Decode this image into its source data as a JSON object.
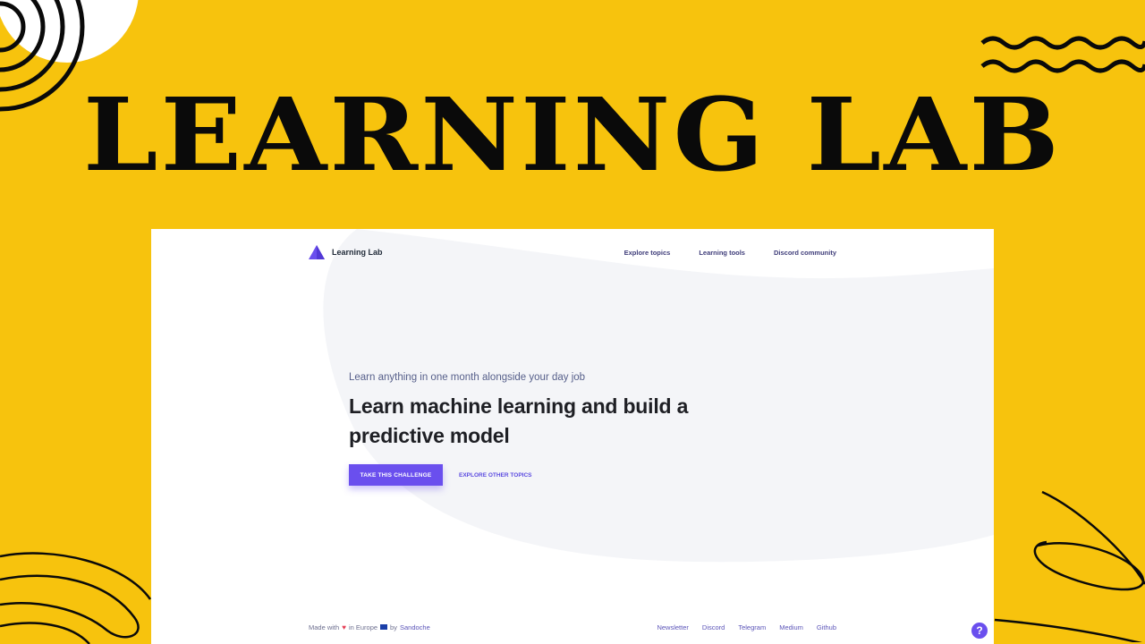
{
  "poster": {
    "title": "LEARNING LAB",
    "background_color": "#f7c30d",
    "title_color": "#0a0a0a"
  },
  "app": {
    "brand": {
      "name": "Learning Lab",
      "logo_icon": "triangle-logo-icon",
      "accent": "#6a4fee"
    },
    "nav": {
      "links": [
        "Explore topics",
        "Learning tools",
        "Discord community"
      ]
    },
    "hero": {
      "kicker": "Learn anything in one month alongside your day job",
      "title": "Learn machine learning and build a predictive model",
      "primary_cta": "TAKE THIS CHALLENGE",
      "secondary_cta": "EXPLORE OTHER TOPICS"
    },
    "footer": {
      "made_with": "Made with",
      "heart_icon": "heart-icon",
      "in_text": "in Europe",
      "flag_icon": "eu-flag-icon",
      "by_text": "by",
      "author": "Sandoche",
      "links": [
        "Newsletter",
        "Discord",
        "Telegram",
        "Medium",
        "Github"
      ]
    },
    "help": {
      "label": "?",
      "icon": "help-icon"
    }
  }
}
